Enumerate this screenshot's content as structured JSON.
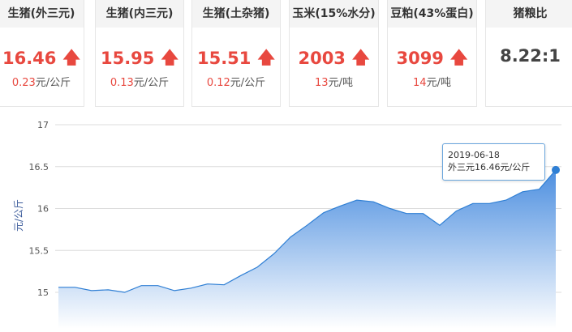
{
  "cards": [
    {
      "title": "生猪(外三元)",
      "price": "16.46",
      "change_value": "0.23",
      "change_unit": "元/公斤",
      "trend": "up"
    },
    {
      "title": "生猪(内三元)",
      "price": "15.95",
      "change_value": "0.13",
      "change_unit": "元/公斤",
      "trend": "up"
    },
    {
      "title": "生猪(土杂猪)",
      "price": "15.51",
      "change_value": "0.12",
      "change_unit": "元/公斤",
      "trend": "up"
    },
    {
      "title": "玉米(15%水分)",
      "price": "2003",
      "change_value": "13",
      "change_unit": "元/吨",
      "trend": "up"
    },
    {
      "title": "豆粕(43%蛋白)",
      "price": "3099",
      "change_value": "14",
      "change_unit": "元/吨",
      "trend": "up"
    },
    {
      "title": "猪粮比",
      "price": "8.22:1"
    }
  ],
  "arrow_glyph": "🡅",
  "tooltip": {
    "date": "2019-06-18",
    "text": "外三元16.46元/公斤"
  },
  "colors": {
    "accent_red": "#e8483f",
    "line_blue": "#2f7fd4",
    "area_top": "#4d8fe0",
    "area_bottom": "#ffffff",
    "grid": "#dcdcdc"
  },
  "chart_data": {
    "type": "area",
    "ylabel": "元/公斤",
    "yticks": [
      "15",
      "15.5",
      "16",
      "16.5",
      "17"
    ],
    "ylim": [
      14.8,
      17
    ],
    "grid": true,
    "series": [
      {
        "values": [
          15.06,
          15.06,
          15.02,
          15.03,
          15.0,
          15.08,
          15.08,
          15.02,
          15.05,
          15.1,
          15.09,
          15.2,
          15.3,
          15.46,
          15.66,
          15.8,
          15.95,
          16.03,
          16.1,
          16.08,
          16.0,
          15.94,
          15.94,
          15.8,
          15.97,
          16.06,
          16.06,
          16.1,
          16.2,
          16.23,
          16.46
        ]
      }
    ],
    "highlight": {
      "index": 30,
      "value": 16.46
    }
  }
}
